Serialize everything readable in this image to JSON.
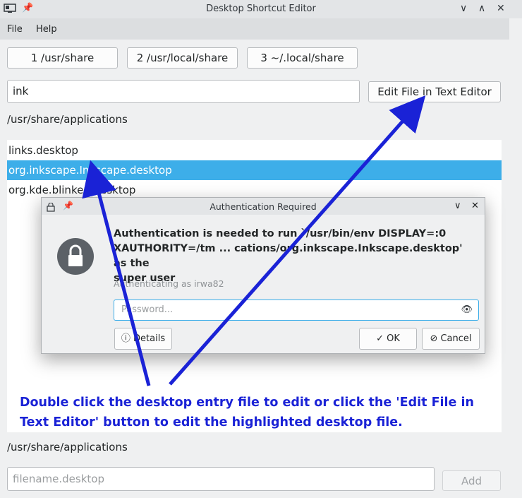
{
  "window": {
    "title": "Desktop Shortcut Editor",
    "controls": [
      "∨",
      "∧",
      "✕"
    ]
  },
  "menu": [
    "File",
    "Help"
  ],
  "location_buttons": [
    "1 /usr/share",
    "2 /usr/local/share",
    "3 ~/.local/share"
  ],
  "search": {
    "value": "ink"
  },
  "edit_button": "Edit File in Text Editor",
  "current_path": "/usr/share/applications",
  "file_list": [
    {
      "name": "links.desktop",
      "selected": false
    },
    {
      "name": "org.inkscape.Inkscape.desktop",
      "selected": true
    },
    {
      "name": "org.kde.blinken.desktop",
      "selected": false
    }
  ],
  "dialog": {
    "title": "Authentication Required",
    "message_line1": "Authentication is needed to run `/usr/bin/env DISPLAY=:0",
    "message_line2": "XAUTHORITY=/tm ... cations/org.inkscape.Inkscape.desktop' as the",
    "message_line3": "super user",
    "authenticating_as": "Authenticating as irwa82",
    "password_placeholder": "Password...",
    "details_label": "Details",
    "ok_label": "OK",
    "cancel_label": "Cancel"
  },
  "annotation": {
    "line1": "Double click the desktop entry file to edit or click the 'Edit File in",
    "line2": "Text Editor' button to edit the highlighted desktop file.",
    "arrow_color": "#1a22d6"
  },
  "bottom": {
    "path": "/usr/share/applications",
    "filename_placeholder": "filename.desktop",
    "add_label": "Add"
  },
  "colors": {
    "selection": "#3daee9",
    "focus": "#3daee9"
  }
}
